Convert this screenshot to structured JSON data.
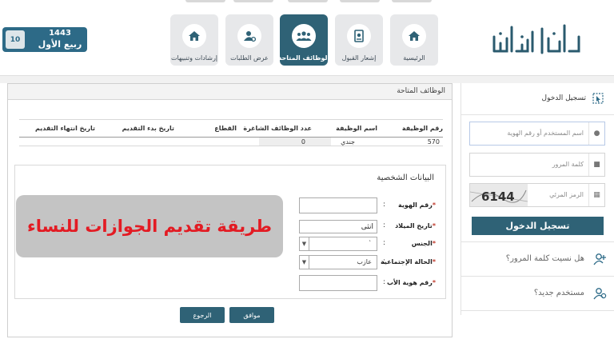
{
  "header": {
    "logo_text": "أبشر | توظيف",
    "nav": [
      {
        "label": "الرئيسية",
        "icon": "home-icon"
      },
      {
        "label": "إشعار القبول",
        "icon": "document-icon"
      },
      {
        "label": "الوظائف المتاحة",
        "icon": "group-icon",
        "active": true
      },
      {
        "label": "عرض الطلبات",
        "icon": "user-settings-icon"
      },
      {
        "label": "إرشادات وتنبيهات",
        "icon": "home-icon"
      }
    ],
    "date": {
      "day": "10",
      "year": "1443",
      "month": "ربيع الأول"
    }
  },
  "main": {
    "title": "الوظائف المتاحة",
    "table": {
      "headers": [
        "رقم الوظيفة",
        "اسم الوظيفة",
        "عدد الوظائف الشاغرة",
        "القطاع",
        "تاريخ بدء التقديم",
        "تاريخ انتهاء التقديم"
      ],
      "rows": [
        {
          "job_number": "570",
          "job_name": "جندي",
          "vacancies": "0",
          "sector": "",
          "start_date": "",
          "end_date": ""
        }
      ]
    },
    "personal": {
      "title": "البيانات الشخصية",
      "fields": {
        "id_number": {
          "label": "رقم الهوية",
          "value": ""
        },
        "birth_date": {
          "label": "تاريخ الميلاد",
          "value": "أنثى"
        },
        "gender": {
          "label": "الجنس",
          "value": "`"
        },
        "marital_status": {
          "label": "الحالة الإجتماعية",
          "value": "عازب"
        },
        "father_id": {
          "label": "رقم هوية الأب",
          "value": ""
        }
      }
    },
    "buttons": {
      "agree": "موافق",
      "back": "الرجوع"
    },
    "overlay_text": "طريقة تقديم الجوازات للنساء"
  },
  "login": {
    "title": "تسجيل الدخول",
    "username_placeholder": "اسم المستخدم أو رقم الهوية",
    "password_placeholder": "كلمة المرور",
    "captcha_placeholder": "الرمز المرئي",
    "captcha_text": "6144",
    "submit": "تسجيل الدخول",
    "forgot": "هل نسيت كلمة المرور؟",
    "new_user": "مستخدم جديد؟"
  },
  "colors": {
    "primary": "#2f6276",
    "accent": "#2d6a87",
    "overlay_text": "#e31b23"
  }
}
